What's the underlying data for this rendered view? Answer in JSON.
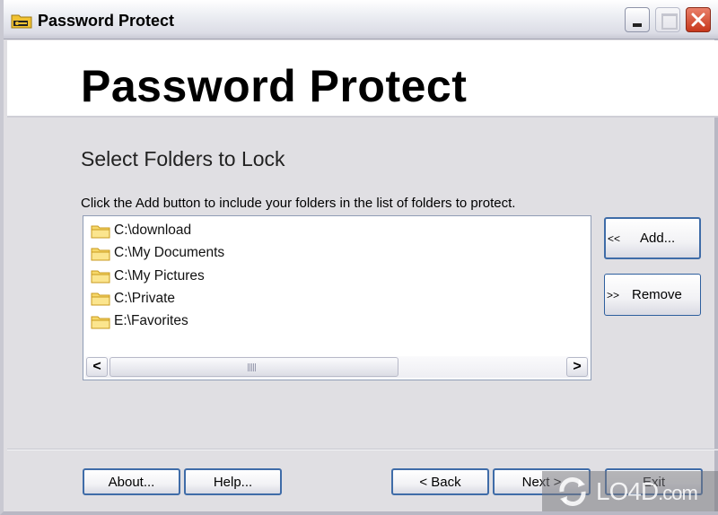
{
  "window": {
    "title": "Password Protect",
    "controls": {
      "minimize": "minimize",
      "maximize": "maximize",
      "close": "close"
    }
  },
  "header": {
    "heading": "Password Protect"
  },
  "page": {
    "subtitle": "Select Folders to Lock",
    "instructions": "Click the Add button to include your folders in the list of folders to protect."
  },
  "folders": [
    {
      "path": "C:\\download"
    },
    {
      "path": "C:\\My Documents"
    },
    {
      "path": "C:\\My Pictures"
    },
    {
      "path": "C:\\Private"
    },
    {
      "path": "E:\\Favorites"
    }
  ],
  "side_buttons": {
    "add": {
      "arrows": "<<",
      "label": "Add..."
    },
    "remove": {
      "arrows": ">>",
      "label": "Remove"
    }
  },
  "scrollbar": {
    "left_arrow": "<",
    "right_arrow": ">"
  },
  "footer": {
    "about": "About...",
    "help": "Help...",
    "back": "< Back",
    "next": "Next >",
    "exit": "Exit"
  },
  "watermark": {
    "text": "LO4D",
    "suffix": ".com"
  }
}
